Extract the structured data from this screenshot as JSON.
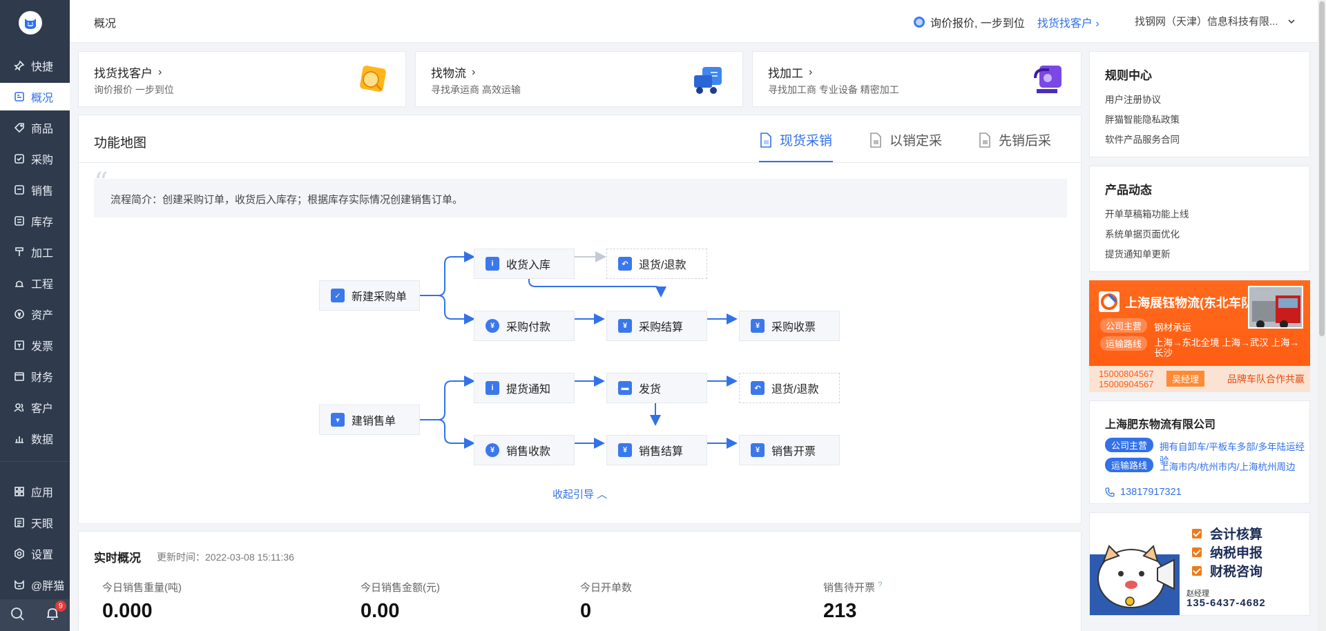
{
  "sidebar": {
    "items": [
      {
        "label": "快捷",
        "icon": "pin-icon"
      },
      {
        "label": "概况",
        "icon": "overview-icon",
        "active": true
      },
      {
        "label": "商品",
        "icon": "tag-icon"
      },
      {
        "label": "采购",
        "icon": "purchase-icon"
      },
      {
        "label": "销售",
        "icon": "sales-icon"
      },
      {
        "label": "库存",
        "icon": "inventory-icon"
      },
      {
        "label": "加工",
        "icon": "processing-icon"
      },
      {
        "label": "工程",
        "icon": "engineering-icon"
      },
      {
        "label": "资产",
        "icon": "assets-icon"
      },
      {
        "label": "发票",
        "icon": "invoice-icon"
      },
      {
        "label": "财务",
        "icon": "finance-icon"
      },
      {
        "label": "客户",
        "icon": "customers-icon"
      },
      {
        "label": "数据",
        "icon": "data-icon"
      }
    ],
    "bottom_items": [
      {
        "label": "应用",
        "icon": "apps-icon"
      },
      {
        "label": "天眼",
        "icon": "skyeye-icon"
      },
      {
        "label": "设置",
        "icon": "settings-icon"
      },
      {
        "label": "@胖猫",
        "icon": "cat-icon"
      }
    ],
    "notification_count": "9"
  },
  "topbar": {
    "title": "概况",
    "promo_text": "询价报价, 一步到位",
    "promo_link": "找货找客户",
    "company": "找钢网（天津）信息科技有限..."
  },
  "quick_cards": [
    {
      "title": "找货找客户",
      "subtitle": "询价报价 一步到位"
    },
    {
      "title": "找物流",
      "subtitle": "寻找承运商 高效运输"
    },
    {
      "title": "找加工",
      "subtitle": "寻找加工商 专业设备 精密加工"
    }
  ],
  "function_map": {
    "title": "功能地图",
    "tabs": [
      "现货采销",
      "以销定采",
      "先销后采"
    ],
    "active_tab": "现货采销",
    "intro": "流程简介：创建采购订单，收货后入库存；根据库存实际情况创建销售订单。",
    "nodes": {
      "new_po": "新建采购单",
      "receive": "收货入库",
      "return1": "退货/退款",
      "pay": "采购付款",
      "po_settle": "采购结算",
      "po_invoice": "采购收票",
      "new_so": "建销售单",
      "pickup": "提货通知",
      "ship": "发货",
      "return2": "退货/退款",
      "collect": "销售收款",
      "so_settle": "销售结算",
      "so_invoice": "销售开票"
    },
    "collapse_label": "收起引导"
  },
  "realtime": {
    "title": "实时概况",
    "updated": "更新时间：2022-03-08 15:11:36",
    "stats": [
      {
        "label": "今日销售重量(吨)",
        "value": "0.000"
      },
      {
        "label": "今日销售金额(元)",
        "value": "0.00"
      },
      {
        "label": "今日开单数",
        "value": "0"
      },
      {
        "label": "销售待开票",
        "value": "213"
      }
    ]
  },
  "rules": {
    "title": "规则中心",
    "links": [
      "用户注册协议",
      "胖猫智能隐私政策",
      "软件产品服务合同"
    ]
  },
  "news": {
    "title": "产品动态",
    "links": [
      "开单草稿箱功能上线",
      "系统单据页面优化",
      "提货通知单更新"
    ]
  },
  "ad_logistics": {
    "name": "上海展钰物流(东北车队)",
    "tag1": "公司主营",
    "tag1_text": "钢材承运",
    "tag2": "运输路线",
    "tag2_text": "上海→东北全境  上海→武汉  上海→长沙",
    "phones": [
      "15000804567",
      "15000904567"
    ],
    "manager": "吴经理",
    "slogan": "品牌车队合作共赢"
  },
  "ad_company": {
    "name": "上海肥东物流有限公司",
    "tag1": "公司主营",
    "tag1_text": "拥有自卸车/平板车多部/多年陆运经验",
    "tag2": "运输路线",
    "tag2_text": "上海市内/杭州市内/上海杭州周边",
    "phone": "13817917321"
  },
  "ad_accounting": {
    "items": [
      "会计核算",
      "纳税申报",
      "财税咨询"
    ],
    "manager": "赵经理",
    "phone": "135-6437-4682"
  }
}
